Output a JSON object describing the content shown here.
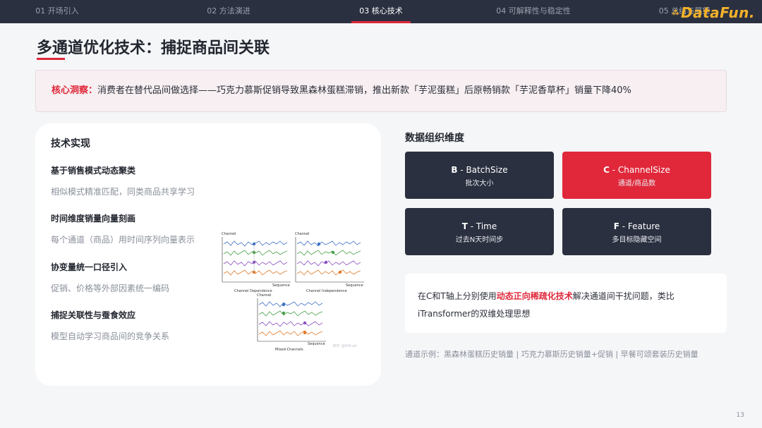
{
  "nav": {
    "tabs": [
      {
        "label": "01 开场引入"
      },
      {
        "label": "02 方法演进"
      },
      {
        "label": "03 核心技术"
      },
      {
        "label": "04 可解释性与稳定性"
      },
      {
        "label": "05 总结与展望"
      }
    ],
    "active_index": 2,
    "logo": "DataFun."
  },
  "title": "多通道优化技术：捕捉商品间关联",
  "insight": {
    "label": "核心洞察：",
    "text": "消费者在替代品间做选择——巧克力慕斯促销导致黑森林蛋糕滞销，推出新款「芋泥蛋糕」后原畅销款「芋泥香草杯」销量下降40%"
  },
  "left": {
    "title": "技术实现",
    "items": [
      {
        "heading": "基于销售模式动态聚类",
        "desc": "相似模式精准匹配，同类商品共享学习"
      },
      {
        "heading": "时间维度销量向量刻画",
        "desc": "每个通道（商品）用时间序列向量表示"
      },
      {
        "heading": "协变量统一口径引入",
        "desc": "促销、价格等外部因素统一编码"
      },
      {
        "heading": "捕捉关联性与蚕食效应",
        "desc": "模型自动学习商品间的竞争关系"
      }
    ],
    "figure": {
      "channel": "Channel",
      "sequence": "Sequence",
      "captions": [
        "Channel Dependence",
        "Channel Independence",
        "Mixed-Channels"
      ],
      "watermark": "知乎 @IGN.ab"
    }
  },
  "right": {
    "title": "数据组织维度",
    "dims": [
      {
        "key": "B",
        "name": " - BatchSize",
        "sub": "批次大小",
        "accent": false
      },
      {
        "key": "C",
        "name": " - ChannelSize",
        "sub": "通道/商品数",
        "accent": true
      },
      {
        "key": "T",
        "name": " - Time",
        "sub": "过去N天时间步",
        "accent": false
      },
      {
        "key": "F",
        "name": " - Feature",
        "sub": "多目标隐藏空间",
        "accent": false
      }
    ],
    "note": {
      "pre": "在C和T轴上分别使用",
      "highlight": "动态正向稀疏化技术",
      "post": "解决通道间干扰问题，类比",
      "line2": "iTransformer的双维处理思想"
    },
    "example": "通道示例：黑森林蛋糕历史销量 | 巧克力慕斯历史销量+促销 | 早餐可颂套装历史销量"
  },
  "page_number": "13",
  "colors": {
    "accent": "#e0283a",
    "dark": "#2b3040",
    "logo": "#f3b12a"
  }
}
